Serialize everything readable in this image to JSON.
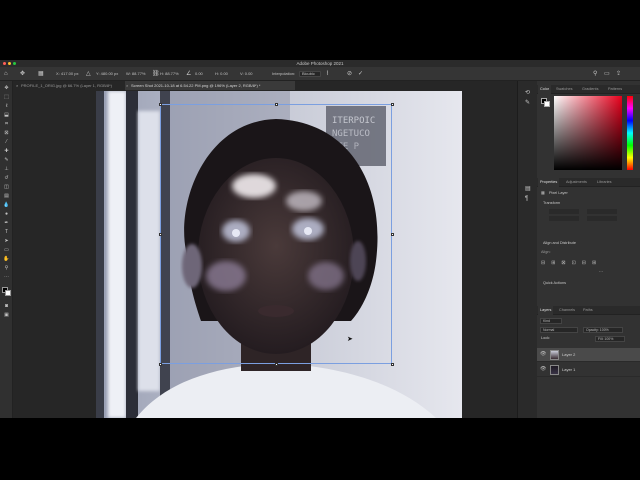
{
  "window": {
    "title": "Adobe Photoshop 2021"
  },
  "options_bar": {
    "x_value": "X: 417.00 px",
    "y_value": "Y: 480.00 px",
    "w_value": "W: 88.77%",
    "h_value": "H: 88.77%",
    "angle": "0.00",
    "h_skew": "H: 0.00",
    "v_skew": "V: 0.00",
    "interpolation_label": "Interpolation:",
    "interpolation_value": "Bicubic"
  },
  "tabs": [
    {
      "label": "PROFILE_1_ORIG.jpg @ 66.7% (Layer 1, RGB/8*)",
      "active": false
    },
    {
      "label": "Screen Shot 2021-10-18 at 6.54.22 PM.png @ 196% (Layer 2, RGB/8*) *",
      "active": true
    }
  ],
  "color_panel": {
    "tabs": [
      "Color",
      "Swatches",
      "Gradients",
      "Patterns"
    ],
    "hue_color": "#e8001c",
    "foreground": "#000000",
    "background": "#ffffff"
  },
  "properties_panel": {
    "tabs": [
      "Properties",
      "Adjustments",
      "Libraries"
    ],
    "layer_kind": "Pixel Layer",
    "sections": [
      "Transform",
      "Align and Distribute",
      "Quick Actions"
    ],
    "align_label": "Align:"
  },
  "layers_panel": {
    "tabs": [
      "Layers",
      "Channels",
      "Paths"
    ],
    "kind_label": "Kind",
    "blend_mode": "Normal",
    "opacity": "Opacity: 100%",
    "lock_label": "Lock:",
    "fill": "Fill: 100%",
    "layers": [
      {
        "name": "Layer 2",
        "selected": true
      },
      {
        "name": "Layer 1",
        "selected": false
      }
    ]
  }
}
